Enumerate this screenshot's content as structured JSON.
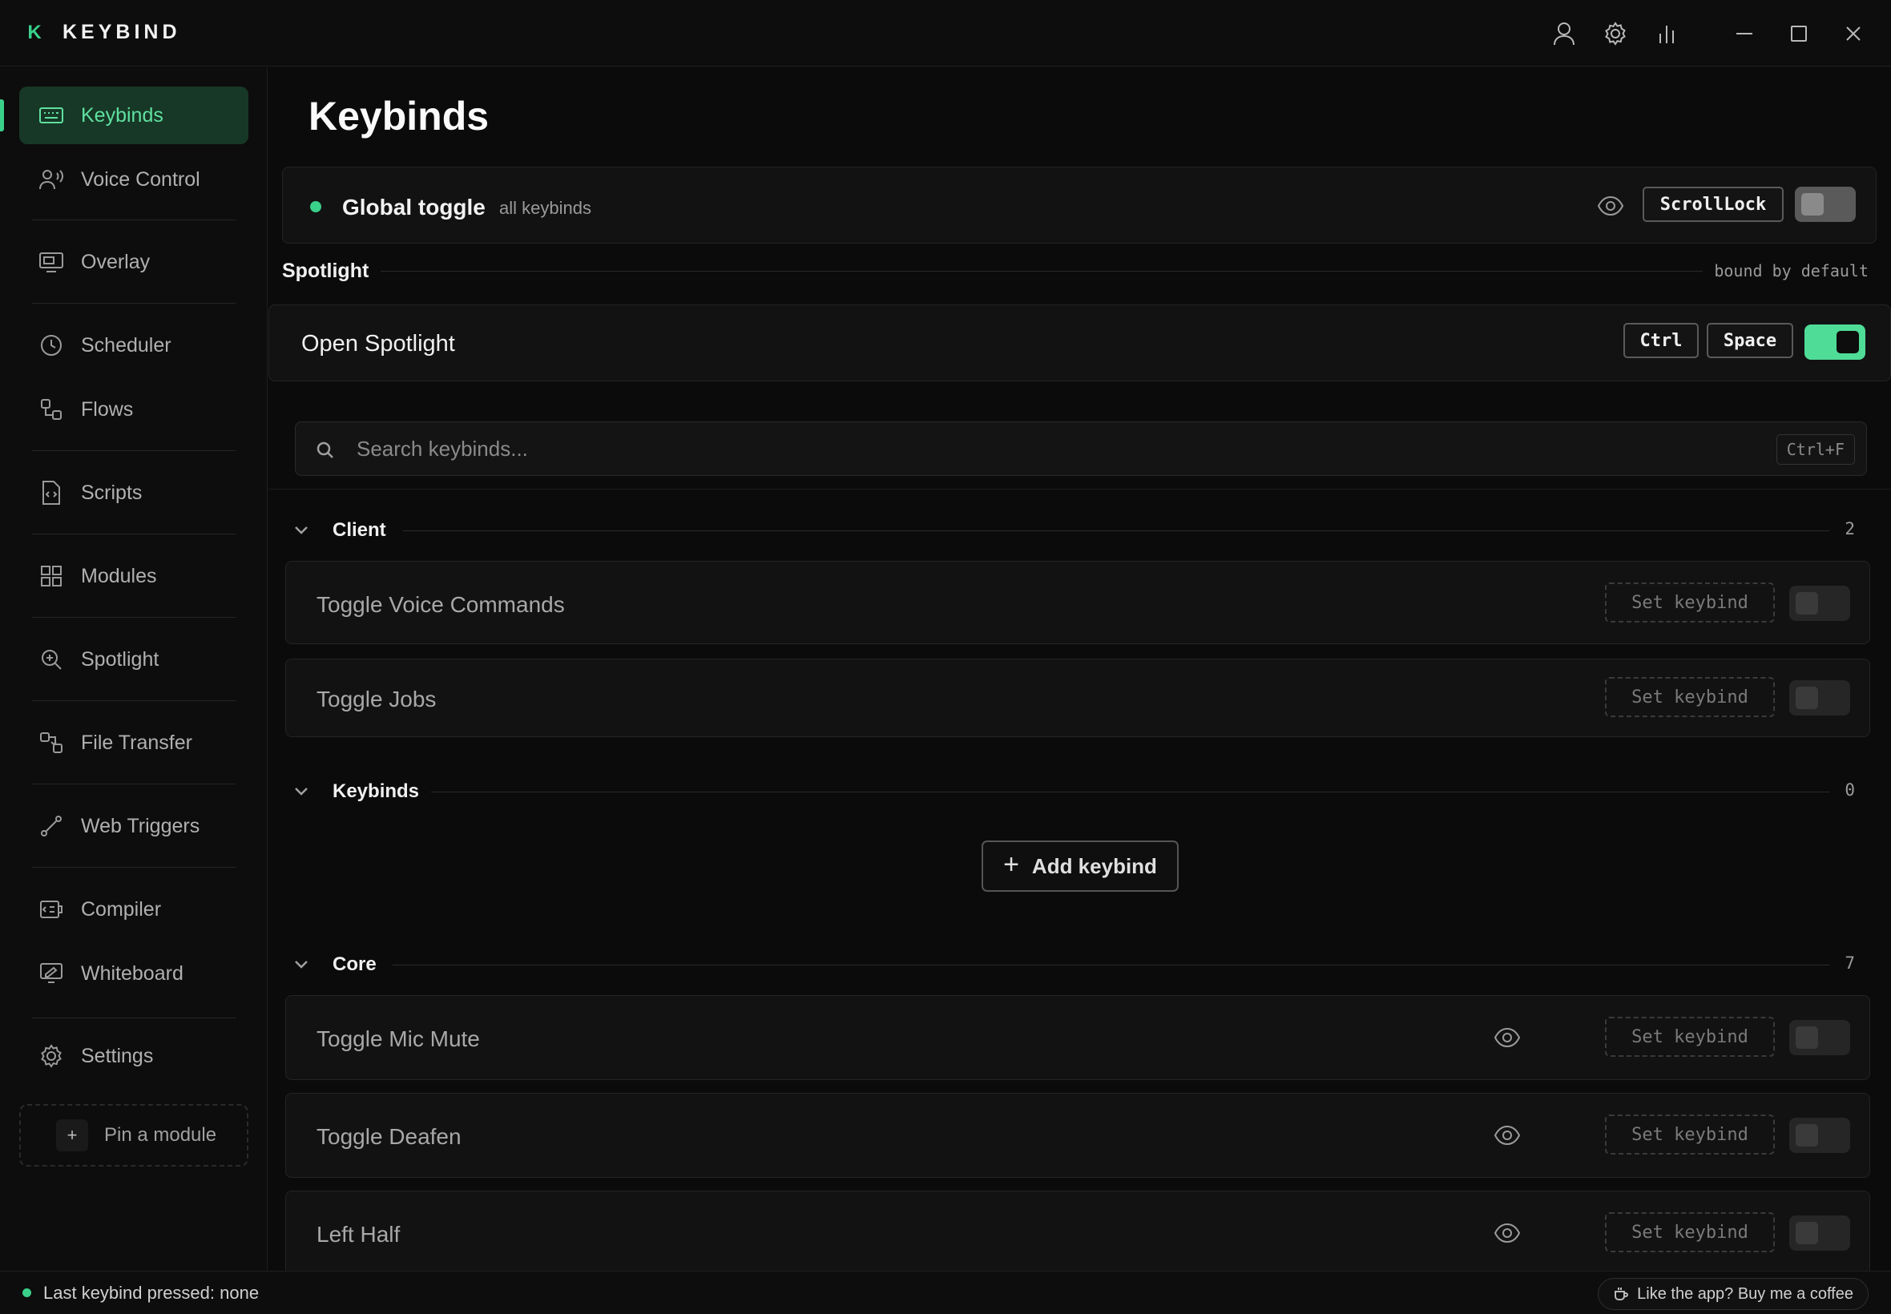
{
  "app": {
    "logo_letter": "K",
    "title": "KEYBIND"
  },
  "titlebar": {
    "icons": [
      "user-icon",
      "gear-icon",
      "stats-icon",
      "minimize-icon",
      "maximize-icon",
      "close-icon"
    ]
  },
  "sidebar": {
    "items": [
      {
        "label": "Keybinds",
        "icon": "keyboard-icon",
        "active": true
      },
      {
        "label": "Voice Control",
        "icon": "voice-icon"
      },
      {
        "label": "Overlay",
        "icon": "monitor-icon"
      },
      {
        "label": "Scheduler",
        "icon": "clock-icon"
      },
      {
        "label": "Flows",
        "icon": "flow-icon"
      },
      {
        "label": "Scripts",
        "icon": "script-icon"
      },
      {
        "label": "Modules",
        "icon": "grid-icon"
      },
      {
        "label": "Spotlight",
        "icon": "spotlight-icon"
      },
      {
        "label": "File Transfer",
        "icon": "transfer-icon"
      },
      {
        "label": "Web Triggers",
        "icon": "trigger-icon"
      },
      {
        "label": "Compiler",
        "icon": "compiler-icon"
      },
      {
        "label": "Whiteboard",
        "icon": "whiteboard-icon"
      },
      {
        "label": "Settings",
        "icon": "gear-icon"
      }
    ],
    "pin_module": {
      "plus": "+",
      "label": "Pin a module"
    }
  },
  "main": {
    "page_title": "Keybinds",
    "global_toggle": {
      "label": "Global toggle",
      "sublabel": "all keybinds",
      "key": "ScrollLock",
      "enabled": false
    },
    "spotlight": {
      "section_label": "Spotlight",
      "note": "bound by default",
      "row_label": "Open Spotlight",
      "keys": [
        "Ctrl",
        "Space"
      ],
      "enabled": true
    },
    "search": {
      "placeholder": "Search keybinds...",
      "shortcut": "Ctrl+F"
    },
    "sections": [
      {
        "label": "Client",
        "count": "2",
        "rows": [
          {
            "label": "Toggle Voice Commands",
            "action": "Set keybind",
            "eye": false
          },
          {
            "label": "Toggle Jobs",
            "action": "Set keybind",
            "eye": false
          }
        ]
      },
      {
        "label": "Keybinds",
        "count": "0",
        "add_label": "Add keybind",
        "add_plus": "+"
      },
      {
        "label": "Core",
        "count": "7",
        "rows": [
          {
            "label": "Toggle Mic Mute",
            "action": "Set keybind",
            "eye": true
          },
          {
            "label": "Toggle Deafen",
            "action": "Set keybind",
            "eye": true
          },
          {
            "label": "Left Half",
            "action": "Set keybind",
            "eye": true
          }
        ]
      }
    ]
  },
  "statusbar": {
    "last_pressed": "Last keybind pressed: none",
    "coffee": "Like the app? Buy me a coffee"
  },
  "colors": {
    "accent": "#3ad08a",
    "toggle_on": "#4fdc97",
    "active_bg": "#173826",
    "background": "#0b0b0b"
  }
}
